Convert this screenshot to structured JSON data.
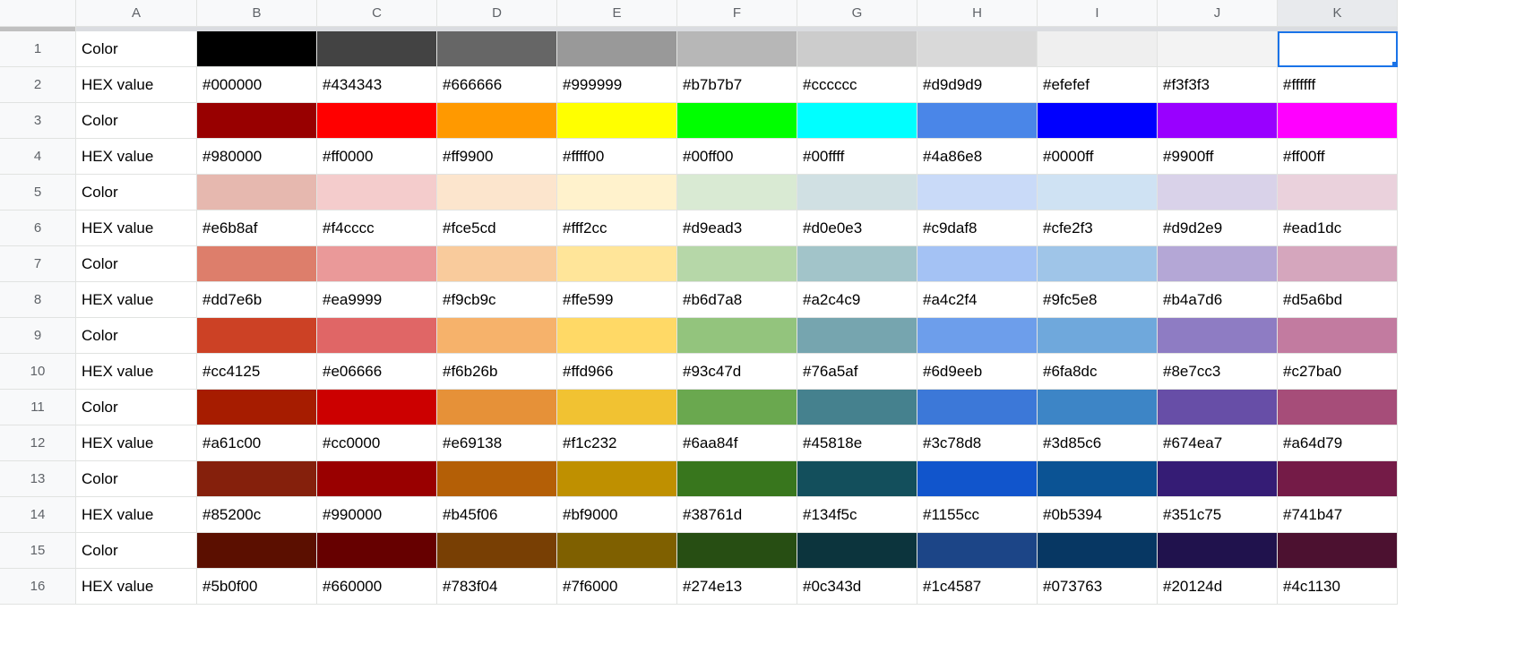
{
  "columns": [
    "A",
    "B",
    "C",
    "D",
    "E",
    "F",
    "G",
    "H",
    "I",
    "J",
    "K"
  ],
  "selectedColumn": "K",
  "activeCell": {
    "row": 1,
    "col": "K"
  },
  "rows": [
    {
      "n": 1,
      "label": "Color",
      "type": "swatch",
      "colors": [
        "#000000",
        "#434343",
        "#666666",
        "#999999",
        "#b7b7b7",
        "#cccccc",
        "#d9d9d9",
        "#efefef",
        "#f3f3f3",
        "#ffffff"
      ]
    },
    {
      "n": 2,
      "label": "HEX value",
      "type": "text",
      "values": [
        "#000000",
        "#434343",
        "#666666",
        "#999999",
        "#b7b7b7",
        "#cccccc",
        "#d9d9d9",
        "#efefef",
        "#f3f3f3",
        "#ffffff"
      ]
    },
    {
      "n": 3,
      "label": "Color",
      "type": "swatch",
      "colors": [
        "#980000",
        "#ff0000",
        "#ff9900",
        "#ffff00",
        "#00ff00",
        "#00ffff",
        "#4a86e8",
        "#0000ff",
        "#9900ff",
        "#ff00ff"
      ]
    },
    {
      "n": 4,
      "label": "HEX value",
      "type": "text",
      "values": [
        "#980000",
        "#ff0000",
        "#ff9900",
        "#ffff00",
        "#00ff00",
        "#00ffff",
        "#4a86e8",
        "#0000ff",
        "#9900ff",
        "#ff00ff"
      ]
    },
    {
      "n": 5,
      "label": "Color",
      "type": "swatch",
      "colors": [
        "#e6b8af",
        "#f4cccc",
        "#fce5cd",
        "#fff2cc",
        "#d9ead3",
        "#d0e0e3",
        "#c9daf8",
        "#cfe2f3",
        "#d9d2e9",
        "#ead1dc"
      ]
    },
    {
      "n": 6,
      "label": "HEX value",
      "type": "text",
      "values": [
        "#e6b8af",
        "#f4cccc",
        "#fce5cd",
        "#fff2cc",
        "#d9ead3",
        "#d0e0e3",
        "#c9daf8",
        "#cfe2f3",
        "#d9d2e9",
        "#ead1dc"
      ]
    },
    {
      "n": 7,
      "label": "Color",
      "type": "swatch",
      "colors": [
        "#dd7e6b",
        "#ea9999",
        "#f9cb9c",
        "#ffe599",
        "#b6d7a8",
        "#a2c4c9",
        "#a4c2f4",
        "#9fc5e8",
        "#b4a7d6",
        "#d5a6bd"
      ]
    },
    {
      "n": 8,
      "label": "HEX value",
      "type": "text",
      "values": [
        "#dd7e6b",
        "#ea9999",
        "#f9cb9c",
        "#ffe599",
        "#b6d7a8",
        "#a2c4c9",
        "#a4c2f4",
        "#9fc5e8",
        "#b4a7d6",
        "#d5a6bd"
      ]
    },
    {
      "n": 9,
      "label": "Color",
      "type": "swatch",
      "colors": [
        "#cc4125",
        "#e06666",
        "#f6b26b",
        "#ffd966",
        "#93c47d",
        "#76a5af",
        "#6d9eeb",
        "#6fa8dc",
        "#8e7cc3",
        "#c27ba0"
      ]
    },
    {
      "n": 10,
      "label": "HEX value",
      "type": "text",
      "values": [
        "#cc4125",
        "#e06666",
        "#f6b26b",
        "#ffd966",
        "#93c47d",
        "#76a5af",
        "#6d9eeb",
        "#6fa8dc",
        "#8e7cc3",
        "#c27ba0"
      ]
    },
    {
      "n": 11,
      "label": "Color",
      "type": "swatch",
      "colors": [
        "#a61c00",
        "#cc0000",
        "#e69138",
        "#f1c232",
        "#6aa84f",
        "#45818e",
        "#3c78d8",
        "#3d85c6",
        "#674ea7",
        "#a64d79"
      ]
    },
    {
      "n": 12,
      "label": "HEX value",
      "type": "text",
      "values": [
        "#a61c00",
        "#cc0000",
        "#e69138",
        "#f1c232",
        "#6aa84f",
        "#45818e",
        "#3c78d8",
        "#3d85c6",
        "#674ea7",
        "#a64d79"
      ]
    },
    {
      "n": 13,
      "label": "Color",
      "type": "swatch",
      "colors": [
        "#85200c",
        "#990000",
        "#b45f06",
        "#bf9000",
        "#38761d",
        "#134f5c",
        "#1155cc",
        "#0b5394",
        "#351c75",
        "#741b47"
      ]
    },
    {
      "n": 14,
      "label": "HEX value",
      "type": "text",
      "values": [
        "#85200c",
        "#990000",
        "#b45f06",
        "#bf9000",
        "#38761d",
        "#134f5c",
        "#1155cc",
        "#0b5394",
        "#351c75",
        "#741b47"
      ]
    },
    {
      "n": 15,
      "label": "Color",
      "type": "swatch",
      "colors": [
        "#5b0f00",
        "#660000",
        "#783f04",
        "#7f6000",
        "#274e13",
        "#0c343d",
        "#1c4587",
        "#073763",
        "#20124d",
        "#4c1130"
      ]
    },
    {
      "n": 16,
      "label": "HEX value",
      "type": "text",
      "values": [
        "#5b0f00",
        "#660000",
        "#783f04",
        "#7f6000",
        "#274e13",
        "#0c343d",
        "#1c4587",
        "#073763",
        "#20124d",
        "#4c1130"
      ]
    }
  ]
}
